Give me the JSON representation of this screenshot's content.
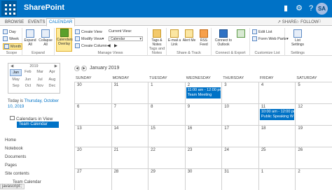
{
  "suitebar": {
    "app_name": "SharePoint",
    "avatar": "SA",
    "icons": [
      "bell-icon",
      "gear-icon",
      "help-icon"
    ]
  },
  "ribbon_tabs": [
    "BROWSE",
    "EVENTS",
    "CALENDAR"
  ],
  "ribbon_tab_active": "CALENDAR",
  "share": {
    "share": "SHARE",
    "follow": "FOLLOW"
  },
  "ribbon": {
    "scope": {
      "label": "Scope",
      "day": "Day",
      "week": "Week",
      "month": "Month"
    },
    "expand": {
      "label": "Expand",
      "expand_all": "Expand All",
      "collapse_all": "Collapse All"
    },
    "calendars_overlay": "Calendars Overlay",
    "manage_views": {
      "label": "Manage Views",
      "create_view": "Create View",
      "modify_view": "Modify View",
      "create_column": "Create Column",
      "current_view_label": "Current View:",
      "current_view_value": "Calendar"
    },
    "tags": {
      "label": "Tags and Notes",
      "tags_notes": "Tags & Notes"
    },
    "share_track": {
      "label": "Share & Track",
      "email_link": "E-mail a Link",
      "alert_me": "Alert Me",
      "rss_feed": "RSS Feed"
    },
    "connect": {
      "label": "Connect & Export",
      "connect_outlook": "Connect to Outlook",
      "export_excel": "Export"
    },
    "customize": {
      "label": "Customize List",
      "edit_list": "Edit List",
      "form_web_parts": "Form Web Parts"
    },
    "settings": {
      "label": "Settings",
      "list_settings": "List Settings"
    }
  },
  "mini_calendar": {
    "year": "2019",
    "months": [
      "Jan",
      "Feb",
      "Mar",
      "Apr",
      "May",
      "Jun",
      "Jul",
      "Aug",
      "Sep",
      "Oct",
      "Nov",
      "Dec"
    ],
    "selected": "Jan"
  },
  "today": {
    "prefix": "Today is",
    "date": "Thursday, October 10, 2019"
  },
  "calendars_in_view": {
    "title": "Calendars in View",
    "calendar": "Team Calendar"
  },
  "quick_links": [
    "Home",
    "Notebook",
    "Documents",
    "Pages",
    "Site contents"
  ],
  "status_text": "javascript:;",
  "calendar": {
    "month_title": "January 2019",
    "days": [
      "SUNDAY",
      "MONDAY",
      "TUESDAY",
      "WEDNESDAY",
      "THURSDAY",
      "FRIDAY",
      "SATURDAY"
    ],
    "weeks": [
      [
        "30",
        "31",
        "1",
        "2",
        "3",
        "4",
        "5"
      ],
      [
        "6",
        "7",
        "8",
        "9",
        "10",
        "11",
        "12"
      ],
      [
        "13",
        "14",
        "15",
        "16",
        "17",
        "18",
        "19"
      ],
      [
        "20",
        "21",
        "22",
        "23",
        "24",
        "25",
        "26"
      ],
      [
        "27",
        "28",
        "29",
        "30",
        "31",
        "1",
        "2"
      ]
    ],
    "events": [
      {
        "time": "11:00 am - 12:00 pm",
        "title": "Team Meeting",
        "week": 0,
        "day": 3
      },
      {
        "time": "10:00 am - 12:00 pm",
        "title": "Public Speaking W",
        "week": 1,
        "day": 5
      }
    ]
  }
}
